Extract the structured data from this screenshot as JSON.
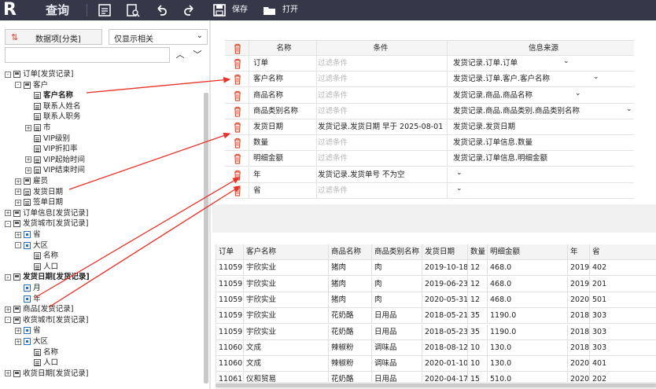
{
  "toolbar": {
    "logo": "R",
    "title": "查询",
    "save_label": "保存",
    "open_label": "打开"
  },
  "left_panel": {
    "field_type_label": "数据项[分类]",
    "filter_value": "仅显示相关",
    "search_placeholder": "",
    "tree": [
      {
        "label": "订单[发货记录]",
        "toggle": "-",
        "icon": "folder"
      },
      {
        "label": "客户",
        "toggle": "-",
        "icon": "folder"
      },
      {
        "label": "客户名称",
        "toggle": "",
        "icon": "field",
        "bold": true
      },
      {
        "label": "联系人姓名",
        "toggle": "",
        "icon": "field"
      },
      {
        "label": "联系人职务",
        "toggle": "",
        "icon": "field"
      },
      {
        "label": "市",
        "toggle": "+",
        "icon": "field"
      },
      {
        "label": "VIP级别",
        "toggle": "",
        "icon": "field"
      },
      {
        "label": "VIP折扣率",
        "toggle": "",
        "icon": "field"
      },
      {
        "label": "VIP起始时间",
        "toggle": "+",
        "icon": "field"
      },
      {
        "label": "VIP结束时间",
        "toggle": "+",
        "icon": "field"
      },
      {
        "label": "雇员",
        "toggle": "+",
        "icon": "folder"
      },
      {
        "label": "发货日期",
        "toggle": "+",
        "icon": "field"
      },
      {
        "label": "签单日期",
        "toggle": "+",
        "icon": "field"
      },
      {
        "label": "订单信息[发货记录]",
        "toggle": "+",
        "icon": "folder"
      },
      {
        "label": "发货城市[发货记录]",
        "toggle": "-",
        "icon": "folder"
      },
      {
        "label": "省",
        "toggle": "+",
        "icon": "hier"
      },
      {
        "label": "大区",
        "toggle": "-",
        "icon": "hier"
      },
      {
        "label": "名称",
        "toggle": "",
        "icon": "field"
      },
      {
        "label": "人口",
        "toggle": "",
        "icon": "field"
      },
      {
        "label": "发货日期[发货记录]",
        "toggle": "-",
        "icon": "folder",
        "bold": true
      },
      {
        "label": "月",
        "toggle": "",
        "icon": "hier"
      },
      {
        "label": "年",
        "toggle": "",
        "icon": "hier"
      },
      {
        "label": "商品[发货记录]",
        "toggle": "+",
        "icon": "folder"
      },
      {
        "label": "收货城市[发货记录]",
        "toggle": "-",
        "icon": "folder"
      },
      {
        "label": "省",
        "toggle": "+",
        "icon": "hier"
      },
      {
        "label": "大区",
        "toggle": "+",
        "icon": "hier"
      },
      {
        "label": "名称",
        "toggle": "",
        "icon": "field"
      },
      {
        "label": "人口",
        "toggle": "",
        "icon": "field"
      },
      {
        "label": "收货日期[发货记录]",
        "toggle": "+",
        "icon": "folder"
      }
    ]
  },
  "conditions": {
    "headers": {
      "name": "名称",
      "condition": "条件",
      "source": "信息来源"
    },
    "rows": [
      {
        "name": "订单",
        "condition": "过滤条件",
        "cond_placeholder": true,
        "source": "发货记录.订单.订单",
        "dropdown": true
      },
      {
        "name": "客户名称",
        "condition": "过滤条件",
        "cond_placeholder": true,
        "source": "发货记录.订单.客户.客户名称",
        "dropdown": true
      },
      {
        "name": "商品名称",
        "condition": "过滤条件",
        "cond_placeholder": true,
        "source": "发货记录.商品.商品名称",
        "dropdown": true
      },
      {
        "name": "商品类别名称",
        "condition": "过滤条件",
        "cond_placeholder": true,
        "source": "发货记录.商品.商品类别.商品类别名称",
        "dropdown": true
      },
      {
        "name": "发货日期",
        "condition": "发货记录.发货日期 早于 2025-08-01...",
        "cond_placeholder": false,
        "source": "发货记录.发货日期",
        "dropdown": false
      },
      {
        "name": "数量",
        "condition": "过滤条件",
        "cond_placeholder": true,
        "source": "发货记录.订单信息.数量",
        "dropdown": false
      },
      {
        "name": "明细金额",
        "condition": "过滤条件",
        "cond_placeholder": true,
        "source": "发货记录.订单信息.明细金额",
        "dropdown": false
      },
      {
        "name": "年",
        "condition": "发货记录.发货单号 不为空",
        "cond_placeholder": false,
        "source": "",
        "dropdown": true
      },
      {
        "name": "省",
        "condition": "过滤条件",
        "cond_placeholder": true,
        "source": "",
        "dropdown": true
      }
    ]
  },
  "results": {
    "headers": [
      "订单",
      "客户名称",
      "商品名称",
      "商品类别名称",
      "发货日期",
      "数量",
      "明细金额",
      "年",
      "省"
    ],
    "rows": [
      [
        "11059",
        "宇欣实业",
        "猪肉",
        "肉",
        "2019-10-18",
        "12",
        "468.0",
        "2019",
        "402"
      ],
      [
        "11059",
        "宇欣实业",
        "猪肉",
        "肉",
        "2019-06-23",
        "12",
        "468.0",
        "2019",
        "201"
      ],
      [
        "11059",
        "宇欣实业",
        "猪肉",
        "肉",
        "2020-05-31",
        "12",
        "468.0",
        "2020",
        "501"
      ],
      [
        "11059",
        "宇欣实业",
        "花奶酪",
        "日用品",
        "2018-05-21",
        "35",
        "1190.0",
        "2018",
        "303"
      ],
      [
        "11059",
        "宇欣实业",
        "花奶酪",
        "日用品",
        "2018-05-23",
        "35",
        "1190.0",
        "2018",
        "303"
      ],
      [
        "11060",
        "文成",
        "辣椒粉",
        "调味品",
        "2018-08-12",
        "10",
        "130.0",
        "2018",
        "303"
      ],
      [
        "11060",
        "文成",
        "辣椒粉",
        "调味品",
        "2020-01-10",
        "10",
        "130.0",
        "2020",
        "401"
      ],
      [
        "11061",
        "仪和贸易",
        "花奶酪",
        "日用品",
        "2020-04-17",
        "15",
        "510.0",
        "2020",
        "202"
      ]
    ]
  },
  "colors": {
    "toolbar_bg": "#36384a",
    "delete_icon": "#e0533b",
    "arrow": "#e8322a"
  }
}
